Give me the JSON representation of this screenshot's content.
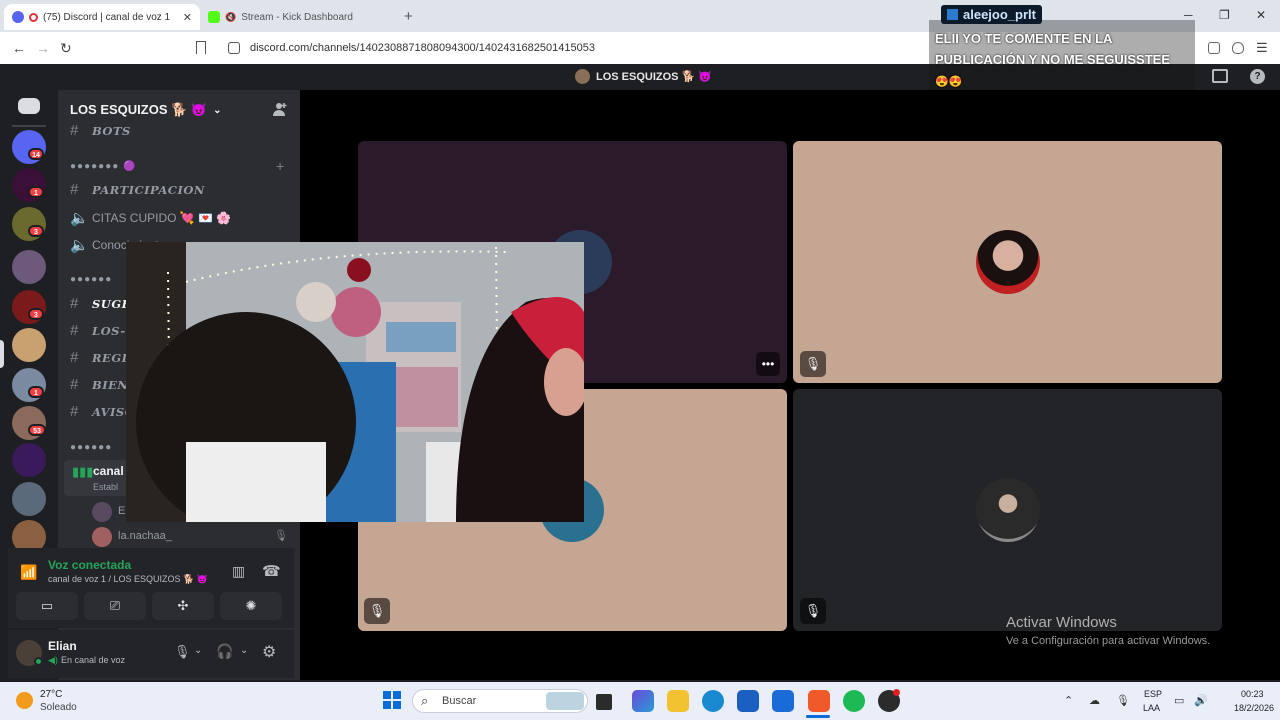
{
  "browser": {
    "tabs": [
      {
        "label": "(75) Discord | canal de voz 1 |",
        "badge": "75"
      },
      {
        "label": "Stream - Kick Dashboard"
      }
    ],
    "url": "discord.com/channels/1402308871808094300/1402431682501415053"
  },
  "stream_chat": {
    "username": "aleejoo_prlt",
    "message": "ELII YO TE COMENTE EN LA PUBLICACIÓN Y NO ME SEGUISSTEE",
    "emotes": "😍😍"
  },
  "discord": {
    "top_title": "LOS ESQUIZOS 🐕 😈",
    "server_badges": [
      "14",
      "1",
      "3",
      "",
      "3",
      "",
      "1",
      "53",
      "",
      "",
      ""
    ],
    "guild_name": "LOS ESQUIZOS 🐕 😈",
    "channels": [
      {
        "type": "text",
        "label": "BOTS",
        "style": "italic"
      },
      {
        "type": "category",
        "label": "●●●●●●● 🟣"
      },
      {
        "type": "text",
        "label": "PARTICIPACION",
        "style": "italic"
      },
      {
        "type": "voice",
        "label": "CITAS CUPIDO 💘 💌 🌸"
      },
      {
        "type": "voice",
        "label": "Conocimientos"
      },
      {
        "type": "category",
        "label": "●●●●●●"
      },
      {
        "type": "text",
        "label": "SUGE",
        "style": "italic"
      },
      {
        "type": "text",
        "label": "LOS-",
        "style": "italic"
      },
      {
        "type": "text",
        "label": "REGL",
        "style": "italic"
      },
      {
        "type": "text",
        "label": "BIEN",
        "style": "italic"
      },
      {
        "type": "text",
        "label": "AVISO",
        "style": "italic"
      },
      {
        "type": "category",
        "label": "●●●●●●"
      }
    ],
    "active_voice_channel": {
      "label": "canal",
      "sub": "Establ"
    },
    "voice_members": [
      "E",
      "la.nachaa_"
    ],
    "voice_connected": {
      "status": "Voz conectada",
      "channel": "canal de voz 1 / LOS ESQUIZOS 🐕 😈"
    },
    "user": {
      "name": "Elian",
      "status": "En canal de voz"
    }
  },
  "windows_watermark": {
    "title": "Activar Windows",
    "subtitle": "Ve a Configuración para activar Windows."
  },
  "taskbar": {
    "weather_temp": "27°C",
    "weather_desc": "Soleado",
    "search_label": "Buscar",
    "lang_top": "ESP",
    "lang_bottom": "LAA",
    "time": "00:23",
    "date": "18/2/2026"
  },
  "colors": {
    "voice_green": "#23a55a",
    "badge_red": "#f23f43",
    "kick_green": "#53fc18",
    "discord_blurple": "#5865f2"
  }
}
